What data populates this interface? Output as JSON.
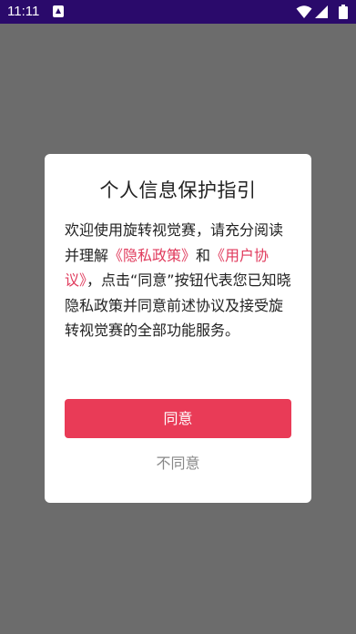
{
  "status_bar": {
    "time": "11:11",
    "background_color": "#2a0a6b",
    "icons": [
      "notification-icon",
      "wifi-icon",
      "signal-icon",
      "battery-icon"
    ]
  },
  "dialog": {
    "title": "个人信息保护指引",
    "body": {
      "part1": "欢迎使用旋转视觉赛，请充分阅读并理解",
      "privacy_link": "《隐私政策》",
      "part2": "和",
      "user_agreement_link": "《用户协议》",
      "part3": "，点击“同意”按钮代表您已知晓隐私政策并同意前述协议及接受旋转视觉赛的全部功能服务。"
    },
    "agree_label": "同意",
    "disagree_label": "不同意",
    "accent_color": "#e93b57",
    "link_color": "#e03a5c"
  }
}
